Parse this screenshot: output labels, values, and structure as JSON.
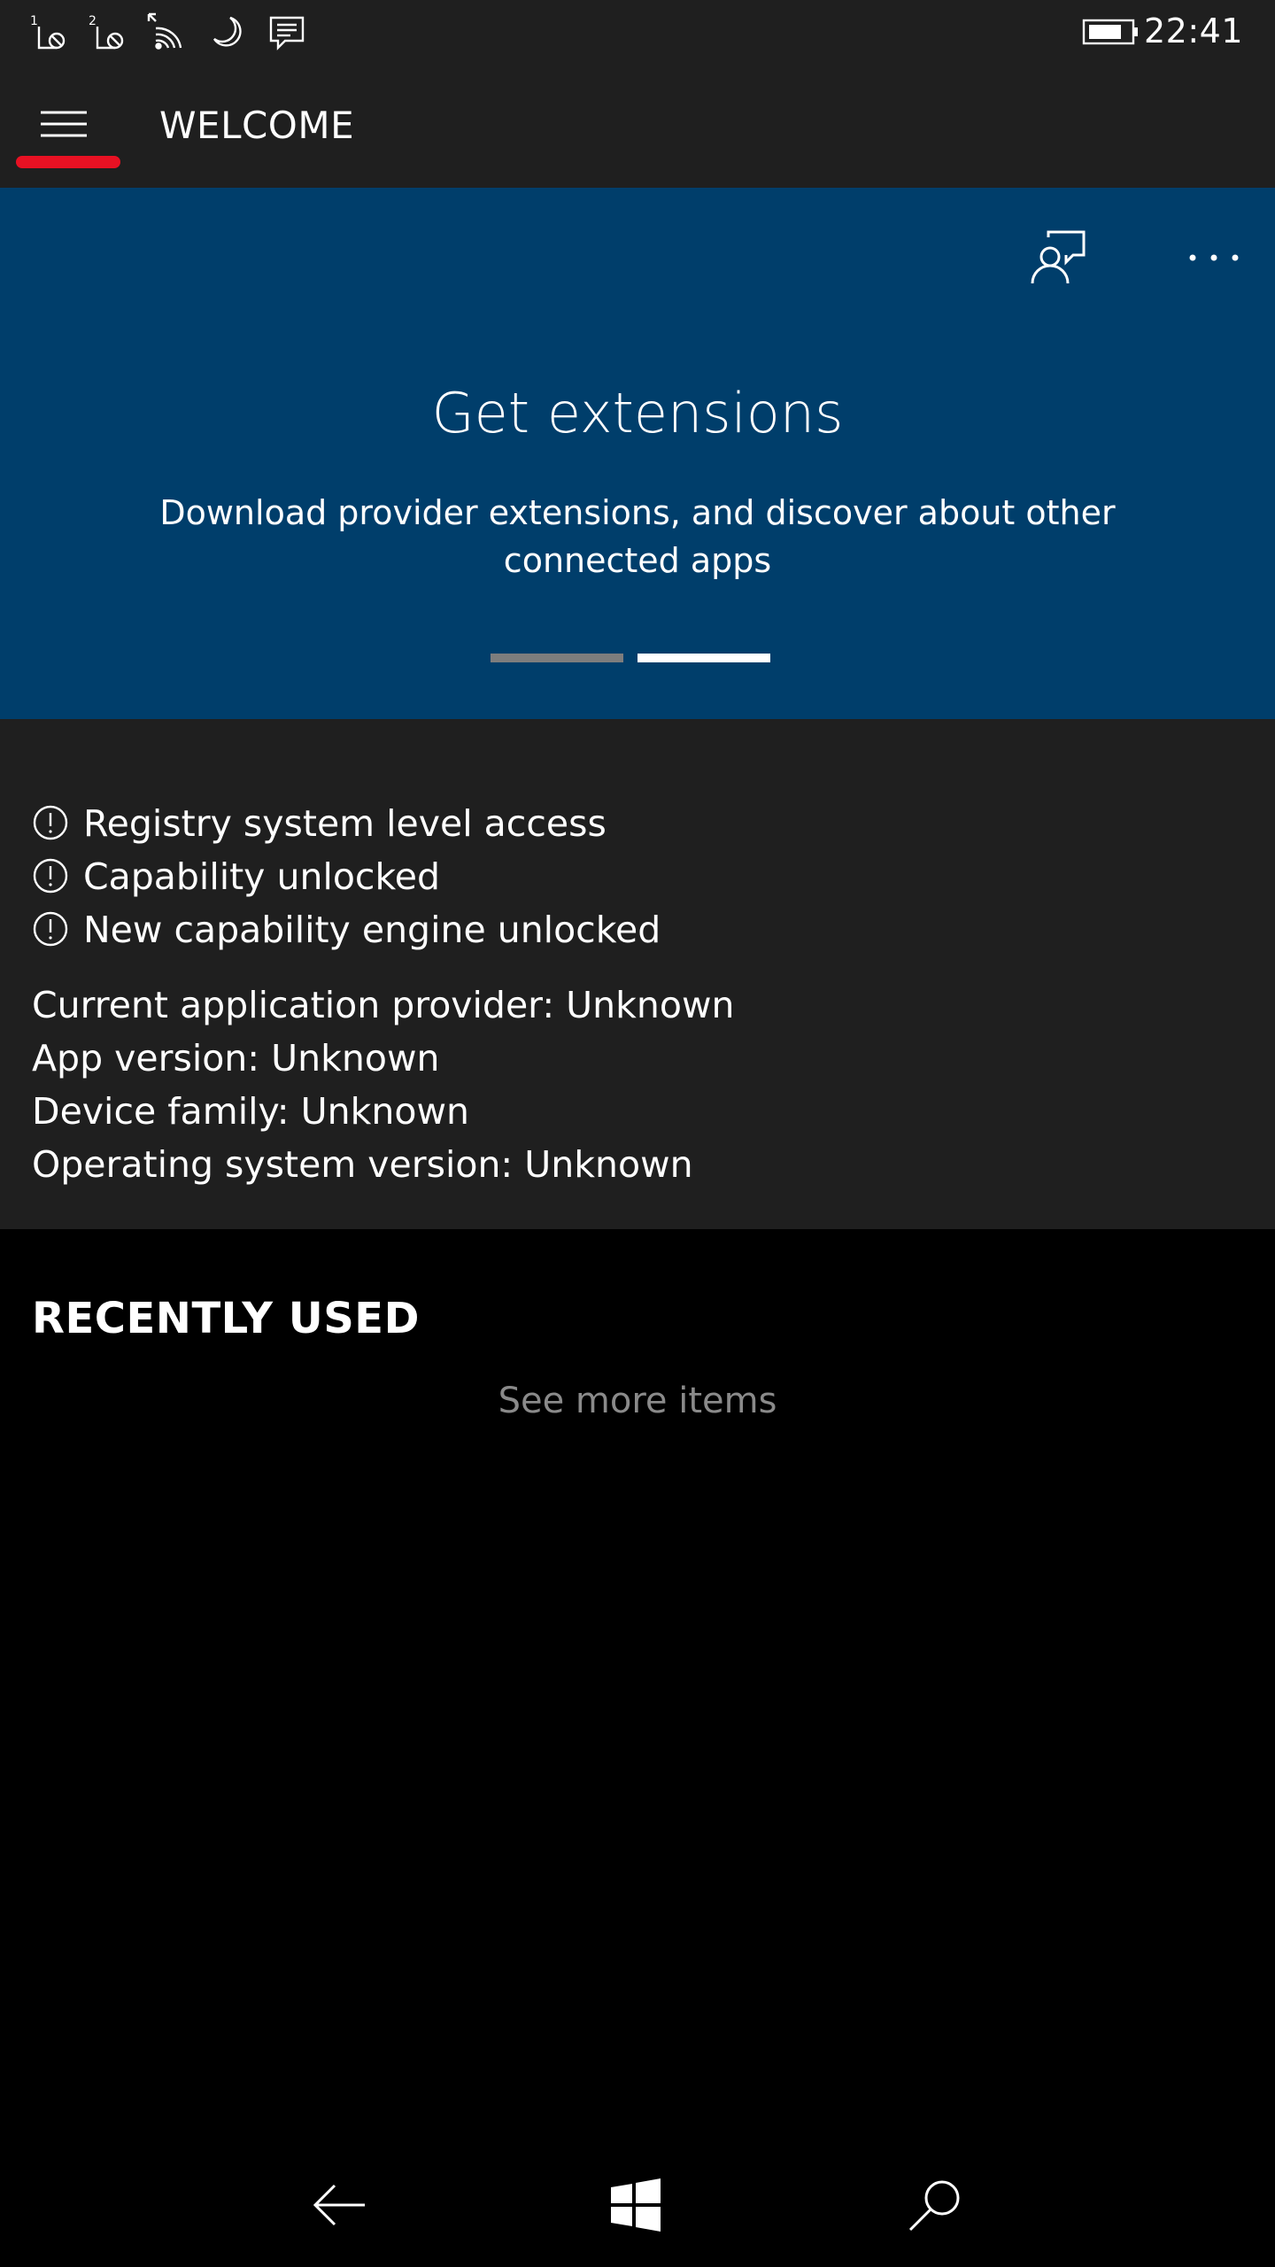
{
  "status_bar": {
    "icons": [
      "sim1-no-signal-icon",
      "sim2-no-signal-icon",
      "wifi-icon",
      "quiet-hours-moon-icon",
      "message-notification-icon",
      "battery-icon"
    ],
    "sim1_number": "1",
    "sim2_number": "2",
    "time": "22:41"
  },
  "header": {
    "menu_icon": "hamburger-menu-icon",
    "accent_color": "#e81123",
    "title": "WELCOME"
  },
  "banner": {
    "background_color": "#003e6b",
    "feedback_icon": "feedback-person-icon",
    "more_icon": "more-options-icon",
    "title": "Get extensions",
    "text": "Download provider extensions, and discover about other connected apps",
    "pager": {
      "pages": 2,
      "selected": 2
    }
  },
  "info": {
    "warnings": [
      {
        "icon": "warning-circle-icon",
        "text": "Registry system level access"
      },
      {
        "icon": "warning-circle-icon",
        "text": "Capability unlocked"
      },
      {
        "icon": "warning-circle-icon",
        "text": "New capability engine unlocked"
      }
    ],
    "details": [
      "Current application provider: Unknown",
      "App version: Unknown",
      "Device family: Unknown",
      "Operating system version: Unknown"
    ]
  },
  "recent": {
    "heading": "RECENTLY USED",
    "see_more": "See more items"
  },
  "nav_bar": {
    "buttons": [
      "back-arrow-icon",
      "windows-start-icon",
      "search-icon"
    ]
  }
}
